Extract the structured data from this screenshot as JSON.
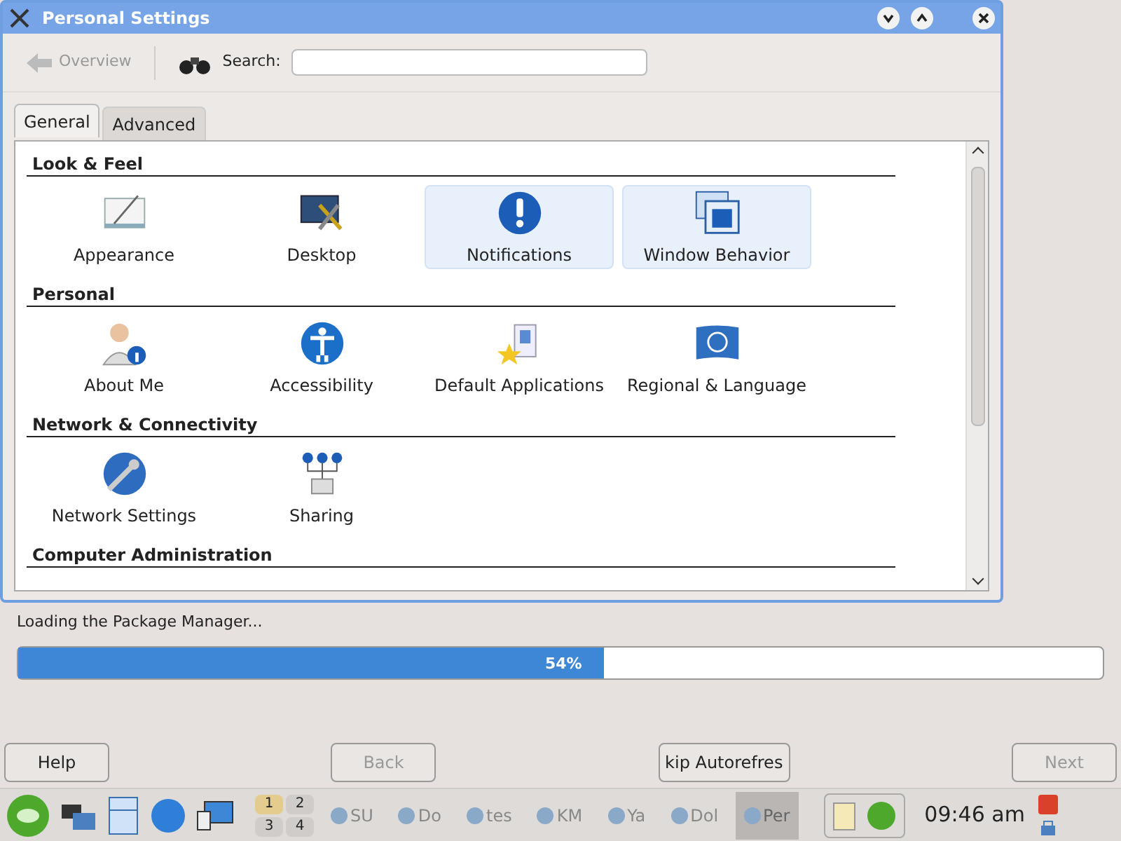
{
  "window": {
    "title": "Personal Settings"
  },
  "toolbar": {
    "overview": {
      "label": "Overview",
      "disabled": true
    },
    "search": {
      "label": "Search:"
    }
  },
  "tabs": [
    {
      "label": "General",
      "selected": true
    },
    {
      "label": "Advanced",
      "selected": false
    }
  ],
  "categories": [
    {
      "title": "Look & Feel",
      "items": [
        {
          "label": "Appearance",
          "highlighted": false
        },
        {
          "label": "Desktop",
          "highlighted": false
        },
        {
          "label": "Notifications",
          "highlighted": true
        },
        {
          "label": "Window Behavior",
          "highlighted": true
        }
      ]
    },
    {
      "title": "Personal",
      "items": [
        {
          "label": "About Me",
          "highlighted": false
        },
        {
          "label": "Accessibility",
          "highlighted": false
        },
        {
          "label": "Default Applications",
          "highlighted": false
        },
        {
          "label": "Regional & Language",
          "highlighted": false
        }
      ]
    },
    {
      "title": "Network & Connectivity",
      "items": [
        {
          "label": "Network Settings",
          "highlighted": false
        },
        {
          "label": "Sharing",
          "highlighted": false
        }
      ]
    },
    {
      "title": "Computer Administration"
    }
  ],
  "status": {
    "text": "Loading the Package Manager...",
    "level": 0.54,
    "reading": "54%"
  },
  "buttons": [
    {
      "label": "Help",
      "disabled": false
    },
    {
      "label": "Back",
      "disabled": true
    },
    {
      "label": "kip Autorefres",
      "disabled": false
    },
    {
      "label": "Next",
      "disabled": true
    }
  ],
  "taskbar": {
    "pager": [
      {
        "label": "1",
        "selected": true
      },
      {
        "label": "2",
        "selected": false
      },
      {
        "label": "3",
        "selected": false
      },
      {
        "label": "4",
        "selected": false
      }
    ],
    "tasks": [
      {
        "label": "SU",
        "selected": false
      },
      {
        "label": "Do",
        "selected": false
      },
      {
        "label": "tes",
        "selected": false
      },
      {
        "label": "KM",
        "selected": false
      },
      {
        "label": "Ya",
        "selected": false
      },
      {
        "label": "Dol",
        "selected": false
      },
      {
        "label": "Per",
        "selected": true
      }
    ],
    "clock": "09:46 am"
  }
}
